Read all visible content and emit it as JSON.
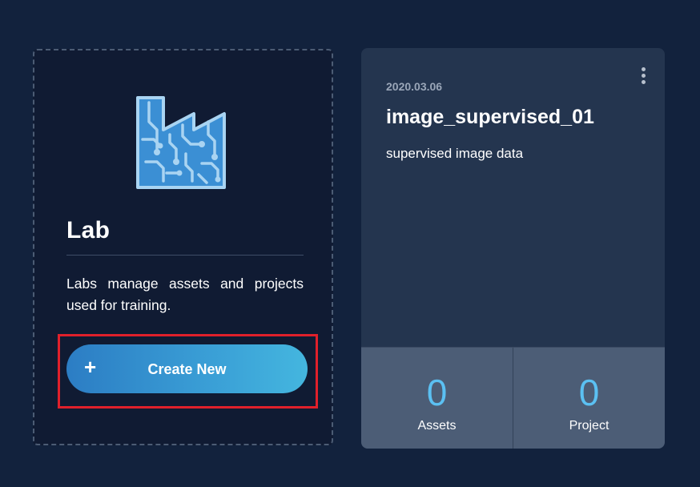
{
  "create_card": {
    "title": "Lab",
    "description": "Labs manage assets and projects used for training.",
    "button_icon": "+",
    "button_label": "Create New",
    "illustration": "factory-circuit-icon",
    "highlight_color": "#e0202b"
  },
  "lab_card": {
    "date": "2020.03.06",
    "title": "image_supervised_01",
    "description": "supervised image data",
    "menu_icon": "more-vertical-icon",
    "stats": [
      {
        "value": "0",
        "label": "Assets"
      },
      {
        "value": "0",
        "label": "Project"
      }
    ]
  },
  "colors": {
    "background": "#12223d",
    "accent": "#5bc0f2",
    "button_gradient_start": "#2c7dc4",
    "button_gradient_end": "#44b6df"
  }
}
